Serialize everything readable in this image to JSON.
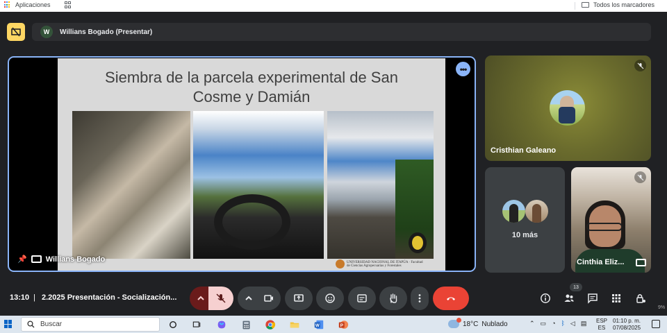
{
  "bookmarks_bar": {
    "apps_label": "Aplicaciones",
    "all_bookmarks_label": "Todos los marcadores"
  },
  "meet": {
    "presenter_bar": {
      "avatar_initial": "W",
      "label": "Willians Bogado (Presentar)"
    },
    "presentation": {
      "slide_title": "Siembra de la parcela experimental de San Cosme y Damián",
      "logo_text": "UNIVERSIDAD NACIONAL DE ITAPÚA · Facultad de Ciencias Agropecuarias y Forestales",
      "presenter_name": "Willians Bogado"
    },
    "tiles": [
      {
        "name": "Cristhian Galeano",
        "muted": true
      },
      {
        "label": "10 más"
      },
      {
        "name": "Cinthia Eliz...",
        "muted": true
      }
    ],
    "controls": {
      "time": "13:10",
      "separator": "|",
      "meeting_title": "2.2025 Presentación - Socialización...",
      "people_count": "13"
    },
    "colors": {
      "accent": "#8ab4f8",
      "end_call": "#ea4335",
      "mic_off_bg": "#f6d0d0",
      "background": "#202124"
    }
  },
  "taskbar": {
    "search_placeholder": "Buscar",
    "weather_temp": "18°C",
    "weather_desc": "Nublado",
    "lang_top": "ESP",
    "lang_bottom": "ES",
    "time": "01:10 p. m.",
    "date": "07/08/2025"
  },
  "edge_text": "9%"
}
